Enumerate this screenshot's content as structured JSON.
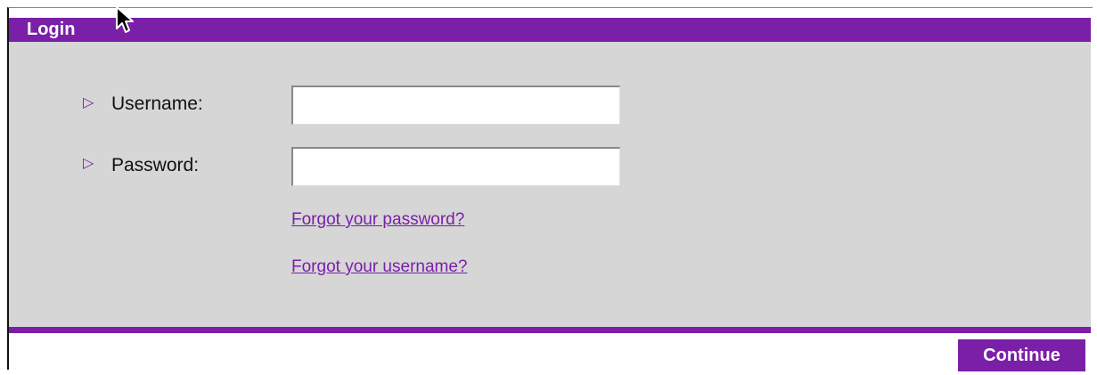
{
  "header": {
    "title": "Login"
  },
  "form": {
    "username": {
      "label": "Username:",
      "value": ""
    },
    "password": {
      "label": "Password:",
      "value": ""
    }
  },
  "links": {
    "forgot_password": "Forgot your password?",
    "forgot_username": "Forgot your username?"
  },
  "actions": {
    "continue_label": "Continue"
  },
  "icons": {
    "bullet": "triangle-right-icon",
    "pointer": "mouse-cursor-icon"
  },
  "colors": {
    "accent": "#7a1fa8",
    "panel": "#d6d6d6"
  }
}
